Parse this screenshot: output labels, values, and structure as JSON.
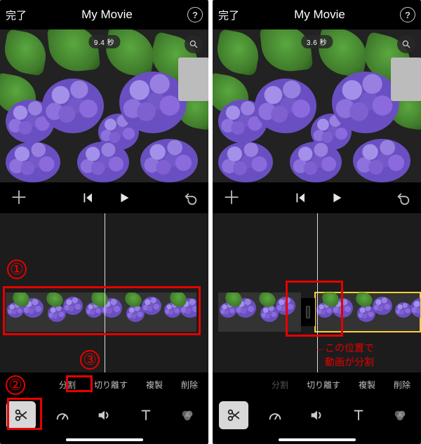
{
  "header": {
    "done": "完了",
    "title": "My Movie",
    "help": "?"
  },
  "preview": {
    "left_time": "9.4 秒",
    "right_time": "3.6 秒"
  },
  "edit_actions": {
    "split": "分割",
    "detach": "切り離す",
    "duplicate": "複製",
    "delete": "削除"
  },
  "annot": {
    "n1": "①",
    "n2": "②",
    "n3": "③",
    "note": "←この位置で\n　動画が分割"
  },
  "icons": {
    "add": "＋",
    "undo": "↶"
  }
}
